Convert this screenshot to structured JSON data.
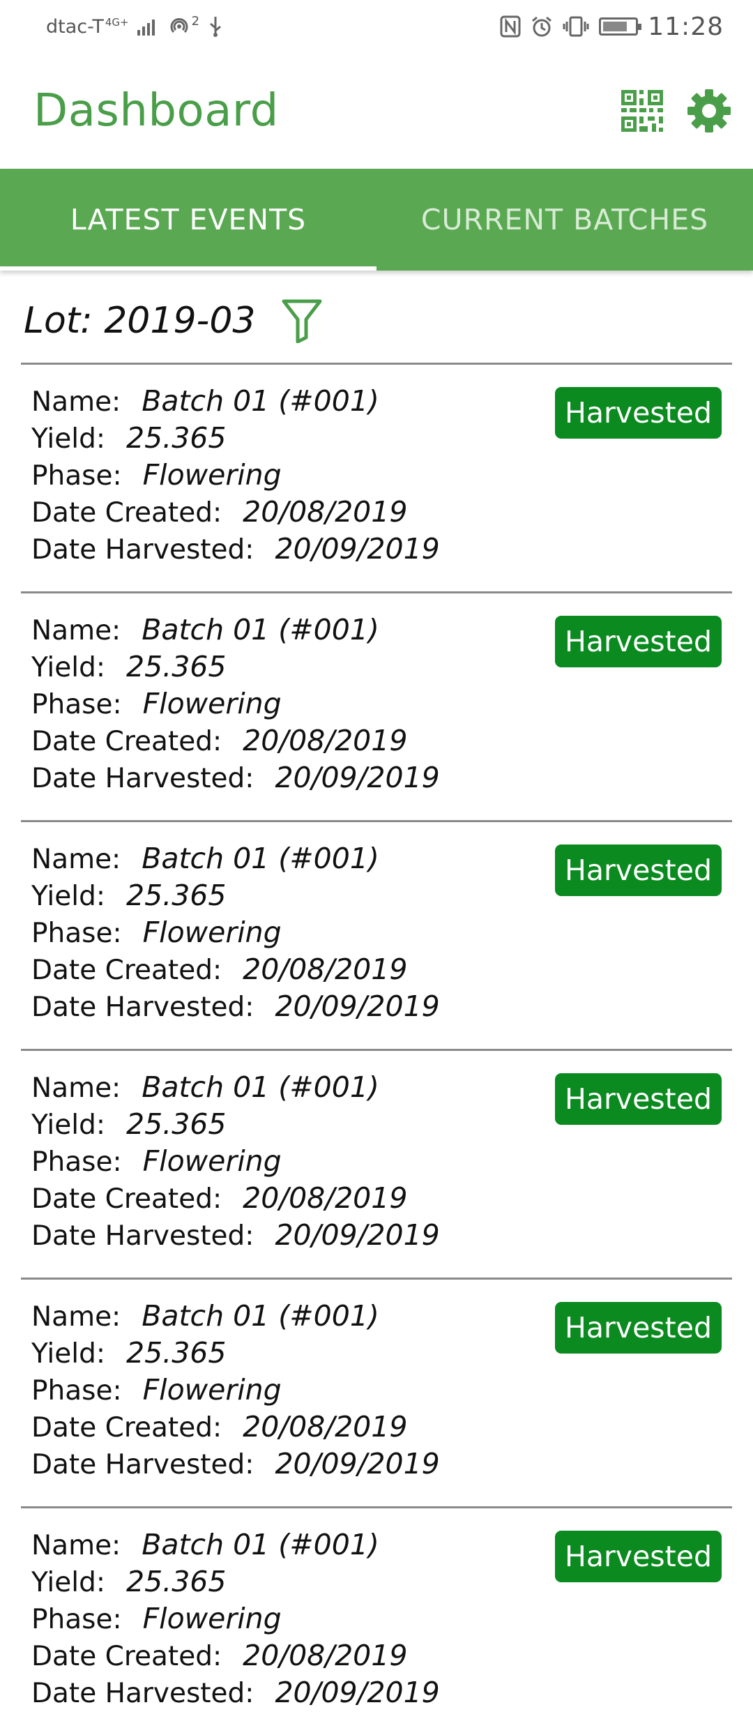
{
  "status_bar": {
    "carrier": "dtac-T",
    "network": "4G+",
    "hotspot_count": "2",
    "time": "11:28"
  },
  "app_bar": {
    "title": "Dashboard",
    "icons": [
      "qr-code-icon",
      "gear-icon"
    ]
  },
  "tabs": [
    {
      "label": "LATEST EVENTS",
      "active": true
    },
    {
      "label": "CURRENT BATCHES",
      "active": false
    }
  ],
  "filter": {
    "lot_text": "Lot: 2019-03"
  },
  "labels": {
    "name": "Name:",
    "yield": "Yield:",
    "phase": "Phase:",
    "date_created": "Date Created:",
    "date_harvested": "Date Harvested:"
  },
  "batches": [
    {
      "name": "Batch 01 (#001)",
      "yield": "25.365",
      "phase": "Flowering",
      "date_created": "20/08/2019",
      "date_harvested": "20/09/2019",
      "status": "Harvested"
    },
    {
      "name": "Batch 01 (#001)",
      "yield": "25.365",
      "phase": "Flowering",
      "date_created": "20/08/2019",
      "date_harvested": "20/09/2019",
      "status": "Harvested"
    },
    {
      "name": "Batch 01 (#001)",
      "yield": "25.365",
      "phase": "Flowering",
      "date_created": "20/08/2019",
      "date_harvested": "20/09/2019",
      "status": "Harvested"
    },
    {
      "name": "Batch 01 (#001)",
      "yield": "25.365",
      "phase": "Flowering",
      "date_created": "20/08/2019",
      "date_harvested": "20/09/2019",
      "status": "Harvested"
    },
    {
      "name": "Batch 01 (#001)",
      "yield": "25.365",
      "phase": "Flowering",
      "date_created": "20/08/2019",
      "date_harvested": "20/09/2019",
      "status": "Harvested"
    },
    {
      "name": "Batch 01 (#001)",
      "yield": "25.365",
      "phase": "Flowering",
      "date_created": "20/08/2019",
      "date_harvested": "20/09/2019",
      "status": "Harvested"
    }
  ],
  "colors": {
    "primary": "#5aa852",
    "title": "#4a9e49",
    "badge": "#0a8a1f"
  }
}
